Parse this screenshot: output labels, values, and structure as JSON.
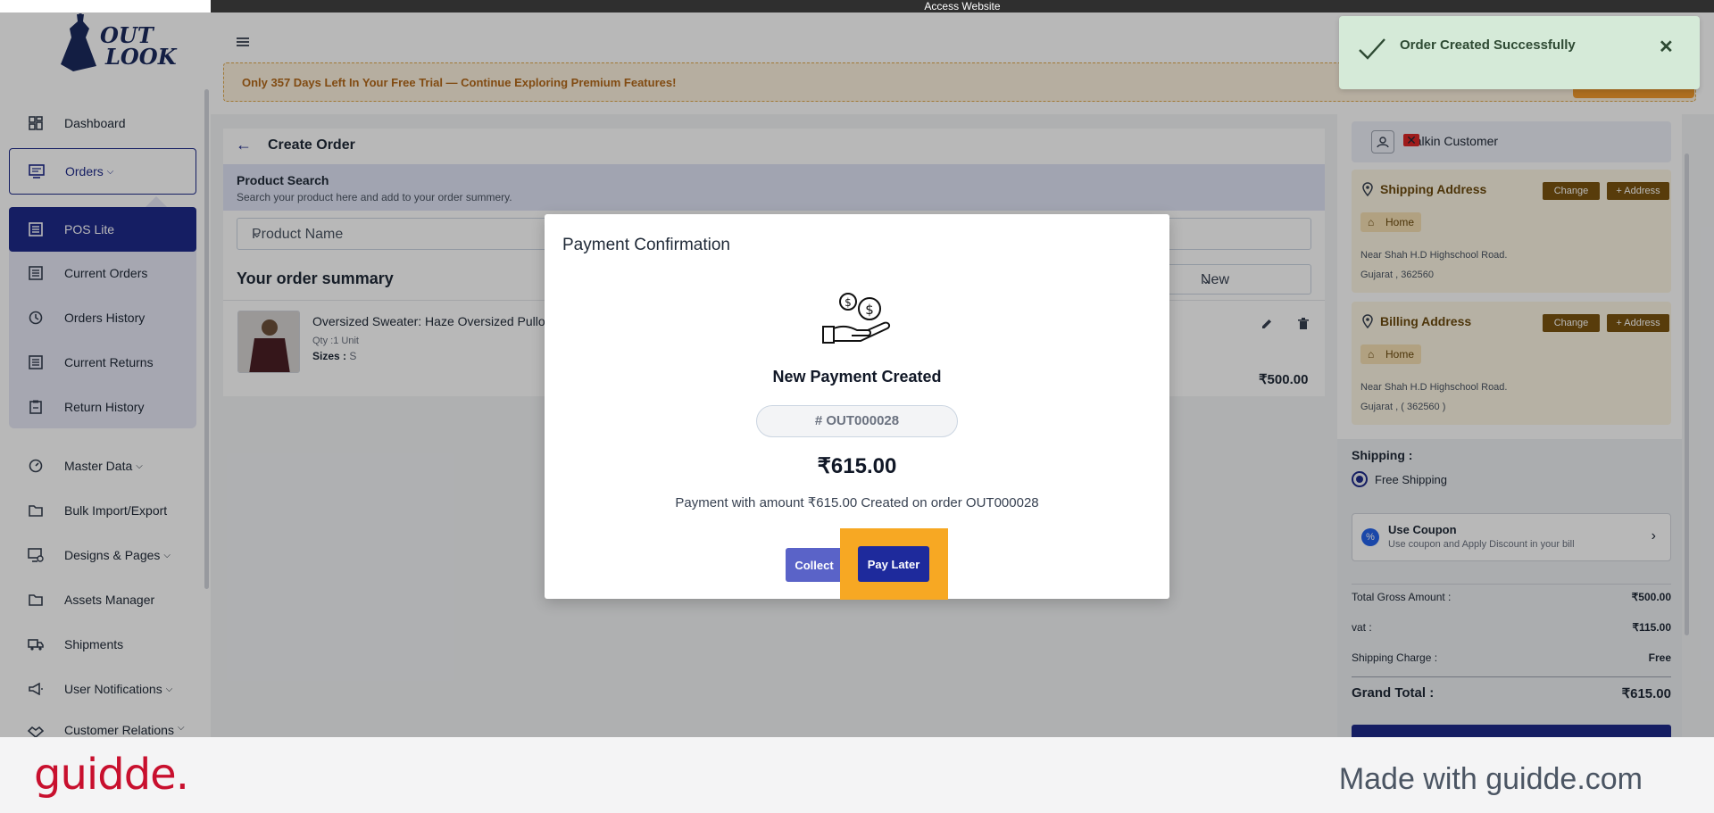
{
  "topbar": {
    "label": "Access Website"
  },
  "brand": {
    "logo_line1": "OUT",
    "logo_line2": "LOOK",
    "primary_color": "#1e2a8a"
  },
  "sidebar": {
    "items": [
      {
        "label": "Dashboard",
        "icon": "dashboard-icon"
      },
      {
        "label": "Orders",
        "icon": "monitor-icon"
      },
      {
        "label": "POS Lite",
        "icon": "list-icon"
      },
      {
        "label": "Current Orders",
        "icon": "list-icon"
      },
      {
        "label": "Orders History",
        "icon": "history-icon"
      },
      {
        "label": "Current Returns",
        "icon": "list-icon"
      },
      {
        "label": "Return History",
        "icon": "clipboard-icon"
      },
      {
        "label": "Master Data",
        "icon": "gauge-icon"
      },
      {
        "label": "Bulk Import/Export",
        "icon": "folder-icon"
      },
      {
        "label": "Designs & Pages",
        "icon": "design-icon"
      },
      {
        "label": "Assets Manager",
        "icon": "folder-icon"
      },
      {
        "label": "Shipments",
        "icon": "truck-icon"
      },
      {
        "label": "User Notifications",
        "icon": "megaphone-icon"
      },
      {
        "label": "Customer Relations",
        "icon": "handshake-icon"
      }
    ]
  },
  "header": {
    "trial_banner": "Only 357 Days Left In Your Free Trial — Continue Exploring Premium Features!"
  },
  "create_order": {
    "title": "Create Order",
    "product_search_title": "Product Search",
    "product_search_sub": "Search your product here and add to your order summery.",
    "product_input_placeholder": "Product Name",
    "summary_title": "Your order summary",
    "status_value": "New",
    "product": {
      "name": "Oversized Sweater: Haze Oversized Pullo",
      "qty": "Qty :1 Unit",
      "sizes_label": "Sizes :",
      "sizes_value": "S",
      "price": "₹500.00"
    }
  },
  "right_panel": {
    "customer": "Walkin Customer",
    "shipping_address": {
      "title": "Shipping Address",
      "change_label": "Change",
      "add_label": "+ Address",
      "chip": "Home",
      "line1": "Near Shah H.D Highschool Road.",
      "line2": "Gujarat , 362560"
    },
    "billing_address": {
      "title": "Billing Address",
      "change_label": "Change",
      "add_label": "+ Address",
      "chip": "Home",
      "line1": "Near Shah H.D Highschool Road.",
      "line2": "Gujarat , ( 362560 )"
    },
    "shipping_label": "Shipping :",
    "shipping_option": "Free Shipping",
    "coupon_title": "Use Coupon",
    "coupon_sub": "Use coupon and Apply Discount in your bill",
    "totals": {
      "gross_label": "Total Gross Amount :",
      "gross_value": "₹500.00",
      "vat_label": "vat :",
      "vat_value": "₹115.00",
      "ship_label": "Shipping Charge :",
      "ship_value": "Free",
      "grand_label": "Grand Total :",
      "grand_value": "₹615.00"
    }
  },
  "toast": {
    "message": "Order Created Successfully"
  },
  "modal": {
    "title": "Payment Confirmation",
    "heading": "New Payment Created",
    "order_id": "# OUT000028",
    "amount": "₹615.00",
    "description": "Payment with amount ₹615.00 Created on order OUT000028",
    "collect_label": "Collect",
    "pay_later_label": "Pay Later",
    "highlight_color": "#f7a823"
  },
  "footer": {
    "logo": "guidde.",
    "made_with": "Made with guidde.com"
  }
}
